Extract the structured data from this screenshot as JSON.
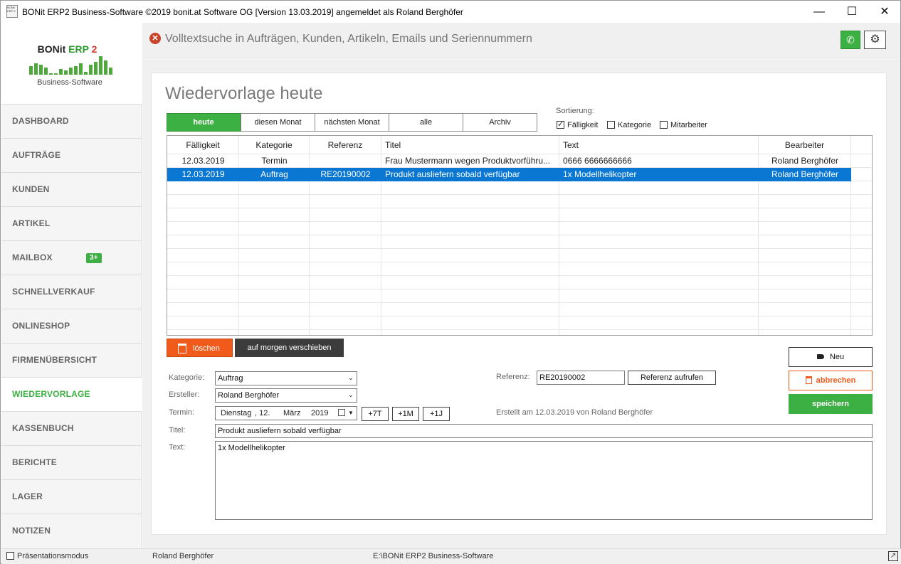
{
  "window": {
    "title": "BONit ERP2 Business-Software ©2019 bonit.at Software OG [Version 13.03.2019] angemeldet als Roland Berghöfer",
    "icon_text": "BONit ERP 2",
    "minimize": "—",
    "maximize": "☐",
    "close": "✕"
  },
  "logo": {
    "brand": "BONit",
    "erp": "ERP",
    "version": "2",
    "subtitle": "Business-Software"
  },
  "sidebar": {
    "items": [
      {
        "label": "DASHBOARD"
      },
      {
        "label": "AUFTRÄGE"
      },
      {
        "label": "KUNDEN"
      },
      {
        "label": "ARTIKEL"
      },
      {
        "label": "MAILBOX",
        "badge": "3+"
      },
      {
        "label": "SCHNELLVERKAUF"
      },
      {
        "label": "ONLINESHOP"
      },
      {
        "label": "FIRMENÜBERSICHT"
      },
      {
        "label": "WIEDERVORLAGE",
        "active": true
      },
      {
        "label": "KASSENBUCH"
      },
      {
        "label": "BERICHTE"
      },
      {
        "label": "LAGER"
      },
      {
        "label": "NOTIZEN"
      }
    ]
  },
  "header": {
    "search_placeholder": "Volltextsuche in Aufträgen, Kunden, Artikeln, Emails und Seriennummern",
    "clear_icon": "✕",
    "phone_icon": "✆",
    "settings_icon": "⚙"
  },
  "page": {
    "title": "Wiedervorlage heute"
  },
  "filter_tabs": [
    {
      "label": "heute",
      "active": true
    },
    {
      "label": "diesen Monat"
    },
    {
      "label": "nächsten Monat"
    },
    {
      "label": "alle"
    },
    {
      "label": "Archiv"
    }
  ],
  "sort": {
    "label": "Sortierung:",
    "options": [
      {
        "label": "Fälligkeit",
        "checked": true
      },
      {
        "label": "Kategorie",
        "checked": false
      },
      {
        "label": "Mitarbeiter",
        "checked": false
      }
    ]
  },
  "grid": {
    "columns": [
      "Fälligkeit",
      "Kategorie",
      "Referenz",
      "Titel",
      "Text",
      "Bearbeiter"
    ],
    "rows": [
      {
        "faelligkeit": "12.03.2019",
        "kategorie": "Termin",
        "referenz": "",
        "titel": "Frau Mustermann wegen Produktvorführu...",
        "text": "0666 6666666666",
        "bearbeiter": "Roland Berghöfer",
        "selected": false
      },
      {
        "faelligkeit": "12.03.2019",
        "kategorie": "Auftrag",
        "referenz": "RE20190002",
        "titel": "Produkt ausliefern sobald verfügbar",
        "text": "1x Modellhelikopter",
        "bearbeiter": "Roland Berghöfer",
        "selected": true
      }
    ]
  },
  "actions": {
    "delete_label": "löschen",
    "postpone_label": "auf morgen verschieben",
    "new_label": "Neu",
    "cancel_label": "abbrechen",
    "save_label": "speichern",
    "new_icon": "tag-icon",
    "cancel_icon": "trash-icon",
    "accent_green": "#3cb043",
    "accent_orange": "#f05a1a"
  },
  "form": {
    "kategorie_label": "Kategorie:",
    "kategorie_value": "Auftrag",
    "ersteller_label": "Ersteller:",
    "ersteller_value": "Roland Berghöfer",
    "termin_label": "Termin:",
    "termin_weekday": "Dienstag",
    "termin_day": ", 12.",
    "termin_month": "März",
    "termin_year": "2019",
    "plus_7t": "+7T",
    "plus_1m": "+1M",
    "plus_1j": "+1J",
    "titel_label": "Titel:",
    "titel_value": "Produkt ausliefern sobald verfügbar",
    "text_label": "Text:",
    "text_value": "1x Modellhelikopter",
    "referenz_label": "Referenz:",
    "referenz_value": "RE20190002",
    "referenz_button": "Referenz aufrufen",
    "created_info": "Erstellt am 12.03.2019 von Roland Berghöfer"
  },
  "statusbar": {
    "presentation_mode": "Präsentationsmodus",
    "user": "Roland Berghöfer",
    "path": "E:\\BONit ERP2 Business-Software"
  }
}
